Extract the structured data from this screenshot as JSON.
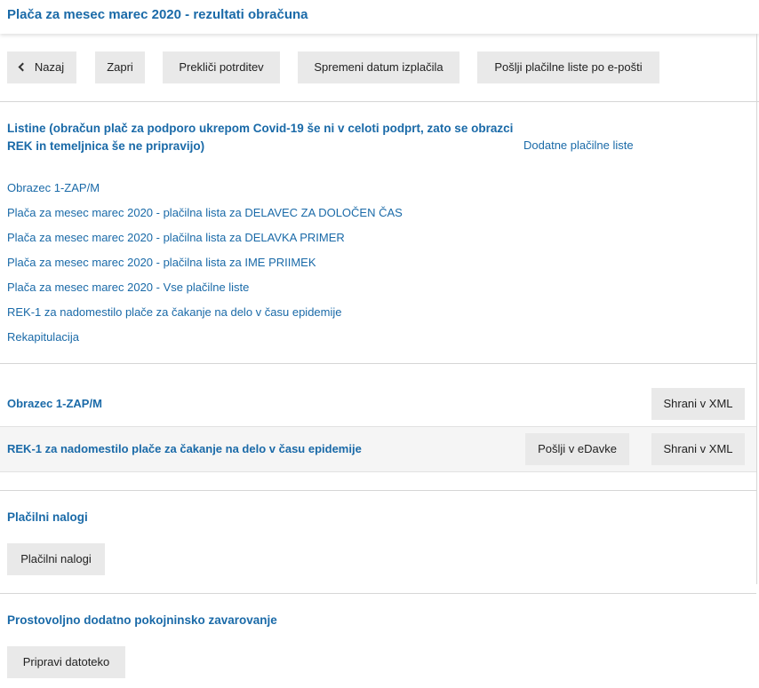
{
  "header": {
    "title": "Plača za mesec marec 2020 - rezultati obračuna"
  },
  "toolbar": {
    "back_label": "Nazaj",
    "close_label": "Zapri",
    "cancel_confirmation_label": "Prekliči potrditev",
    "change_date_label": "Spremeni datum izplačila",
    "send_payslips_label": "Pošlji plačilne liste po e-pošti"
  },
  "listings": {
    "title": "Listine (obračun plač za podporo ukrepom Covid-19 še ni v celoti podprt, zato se obrazci REK in temeljnica še ne pripravijo)",
    "additional_link": "Dodatne plačilne liste",
    "items": [
      "Obrazec 1-ZAP/M",
      "Plača za mesec marec 2020 - plačilna lista za DELAVEC ZA DOLOČEN ČAS",
      "Plača za mesec marec 2020 - plačilna lista za DELAVKA PRIMER",
      "Plača za mesec marec 2020 - plačilna lista za IME PRIIMEK",
      "Plača za mesec marec 2020 - Vse plačilne liste",
      "REK-1 za nadomestilo plače za čakanje na delo v času epidemije",
      "Rekapitulacija"
    ]
  },
  "forms": {
    "rows": [
      {
        "label": "Obrazec 1-ZAP/M",
        "save_xml": "Shrani v XML"
      },
      {
        "label": "REK-1 za nadomestilo plače za čakanje na delo v času epidemije",
        "send_edavke": "Pošlji v eDavke",
        "save_xml": "Shrani v XML"
      }
    ]
  },
  "payment_orders": {
    "title": "Plačilni nalogi",
    "button_label": "Plačilni nalogi"
  },
  "pension": {
    "title": "Prostovoljno dodatno pokojninsko zavarovanje",
    "button_label": "Pripravi datoteko"
  }
}
